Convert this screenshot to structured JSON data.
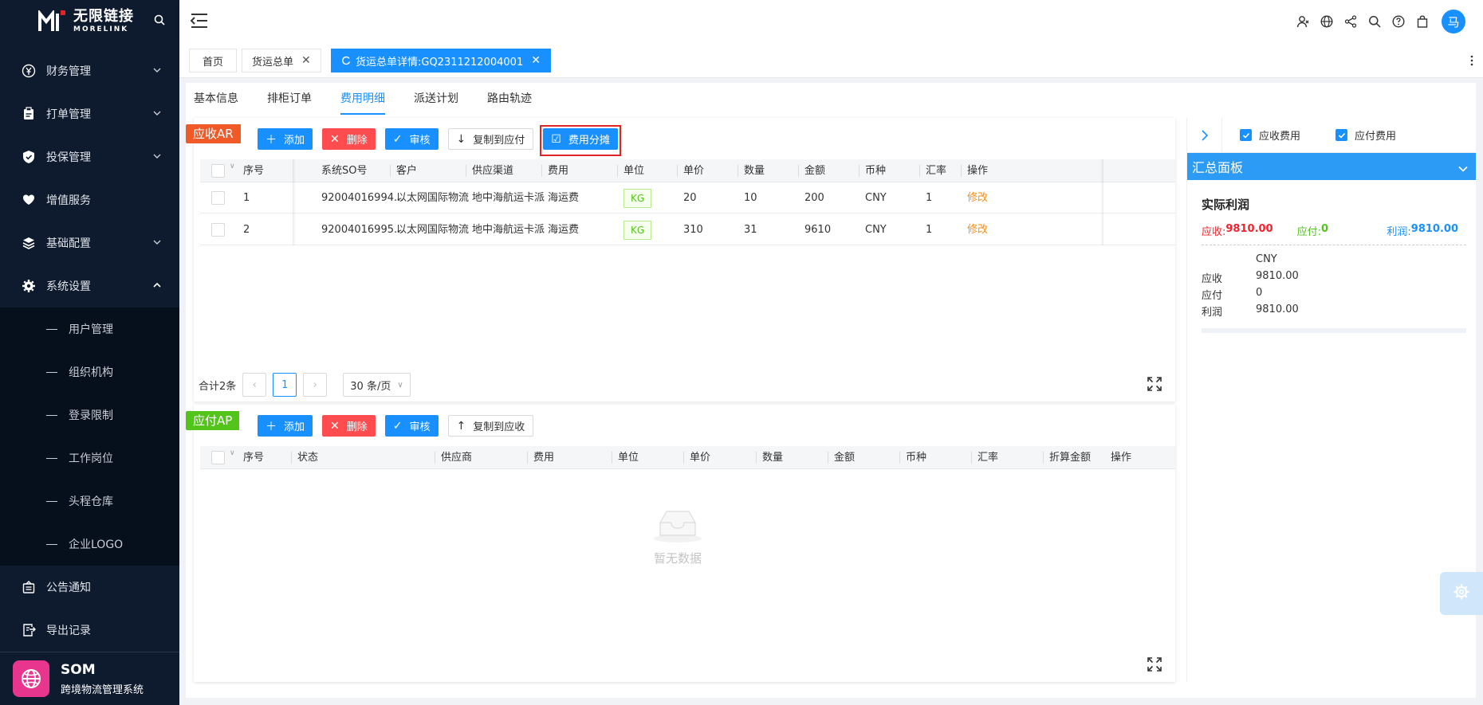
{
  "logo": {
    "cn": "无限链接",
    "en": "MORELINK"
  },
  "sidebar": {
    "items": [
      {
        "label": "财务管理"
      },
      {
        "label": "打单管理"
      },
      {
        "label": "投保管理"
      },
      {
        "label": "增值服务"
      },
      {
        "label": "基础配置"
      },
      {
        "label": "系统设置"
      }
    ],
    "submenu": [
      {
        "label": "用户管理"
      },
      {
        "label": "组织机构"
      },
      {
        "label": "登录限制"
      },
      {
        "label": "工作岗位"
      },
      {
        "label": "头程仓库"
      },
      {
        "label": "企业LOGO"
      }
    ],
    "bottom_items": [
      {
        "label": "公告通知"
      },
      {
        "label": "导出记录"
      }
    ],
    "footer": {
      "title": "SOM",
      "subtitle": "跨境物流管理系统"
    }
  },
  "header": {
    "avatar": "马"
  },
  "tabs": [
    {
      "label": "首页"
    },
    {
      "label": "货运总单"
    },
    {
      "label": "货运总单详情:GQ2311212004001"
    }
  ],
  "subtabs": [
    {
      "label": "基本信息"
    },
    {
      "label": "排柜订单"
    },
    {
      "label": "费用明细"
    },
    {
      "label": "派送计划"
    },
    {
      "label": "路由轨迹"
    }
  ],
  "ar": {
    "flag": "应收AR",
    "buttons": {
      "add": "添加",
      "delete": "删除",
      "audit": "审核",
      "copy": "复制到应付",
      "allocate": "费用分摊"
    },
    "columns": [
      "序号",
      "系统SO号",
      "客户",
      "供应渠道",
      "费用",
      "单位",
      "单价",
      "数量",
      "金额",
      "币种",
      "汇率",
      "操作"
    ],
    "rows": [
      {
        "no": "1",
        "so": "92004016994...",
        "customer": "以太网国际物流",
        "channel": "地中海航运卡派",
        "fee": "海运费",
        "unit": "KG",
        "price": "20",
        "qty": "10",
        "amount": "200",
        "currency": "CNY",
        "rate": "1",
        "op": "修改"
      },
      {
        "no": "2",
        "so": "92004016995...",
        "customer": "以太网国际物流",
        "channel": "地中海航运卡派",
        "fee": "海运费",
        "unit": "KG",
        "price": "310",
        "qty": "31",
        "amount": "9610",
        "currency": "CNY",
        "rate": "1",
        "op": "修改"
      }
    ],
    "pager": {
      "total": "合计2条",
      "current": "1",
      "size": "30 条/页"
    }
  },
  "ap": {
    "flag": "应付AP",
    "buttons": {
      "add": "添加",
      "delete": "删除",
      "audit": "审核",
      "copy": "复制到应收"
    },
    "columns": [
      "序号",
      "状态",
      "供应商",
      "费用",
      "单位",
      "单价",
      "数量",
      "金额",
      "币种",
      "汇率",
      "折算金额",
      "操作"
    ],
    "empty": "暂无数据"
  },
  "right_panel": {
    "check_receivable": "应收费用",
    "check_payable": "应付费用",
    "summary_title": "汇总面板",
    "profit_title": "实际利润",
    "receivable_label": "应收:",
    "receivable_value": "9810.00",
    "payable_label": "应付:",
    "payable_value": "0",
    "profit_label": "利润:",
    "profit_value": "9810.00",
    "currency": "CNY",
    "stats": [
      {
        "label": "应收",
        "value": "9810.00"
      },
      {
        "label": "应付",
        "value": "0"
      },
      {
        "label": "利润",
        "value": "9810.00"
      }
    ]
  },
  "colors": {
    "primary": "#1890ff",
    "sidebar": "#0e1a2e",
    "ar_flag": "#f05a28",
    "ap_flag": "#52c41a",
    "danger": "#ff4d4f"
  }
}
